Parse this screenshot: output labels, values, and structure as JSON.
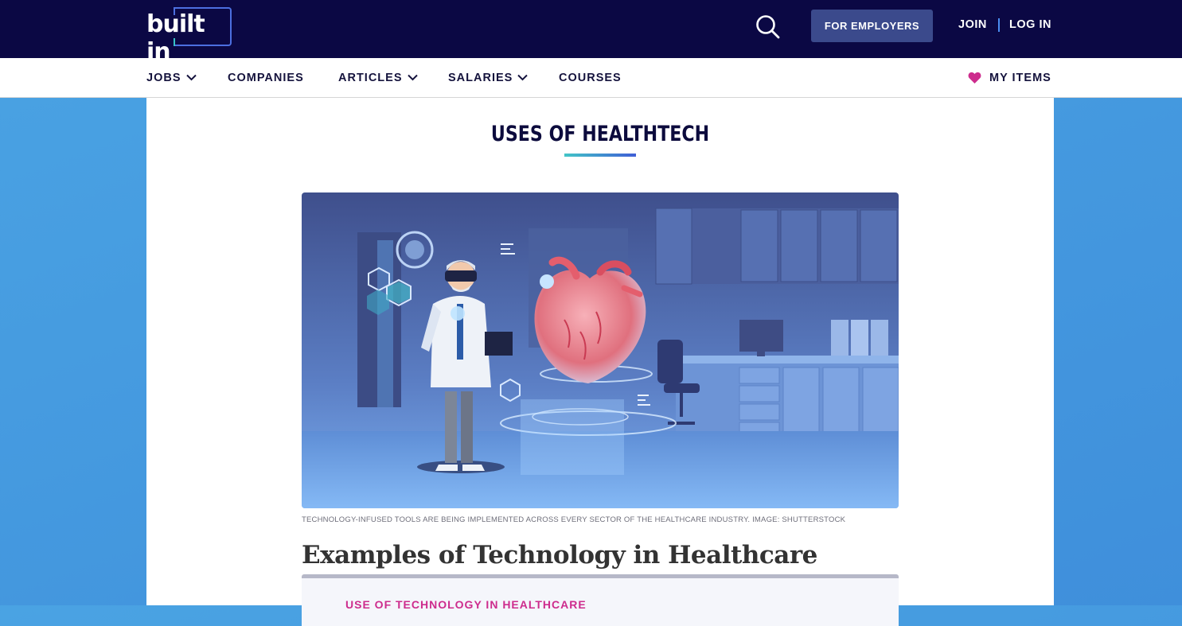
{
  "header": {
    "logo_text": "built in",
    "for_employers": "FOR EMPLOYERS",
    "join": "JOIN",
    "login": "LOG IN"
  },
  "nav": {
    "items": [
      {
        "label": "JOBS",
        "dropdown": true
      },
      {
        "label": "COMPANIES",
        "dropdown": false
      },
      {
        "label": "ARTICLES",
        "dropdown": true
      },
      {
        "label": "SALARIES",
        "dropdown": true
      },
      {
        "label": "COURSES",
        "dropdown": false
      }
    ],
    "my_items": "MY ITEMS"
  },
  "article": {
    "section_title": "USES OF HEALTHTECH",
    "image_caption": "TECHNOLOGY-INFUSED TOOLS ARE BEING IMPLEMENTED ACROSS EVERY SECTOR OF THE HEALTHCARE INDUSTRY. IMAGE: SHUTTERSTOCK",
    "heading": "Examples of Technology in Healthcare",
    "toc_label": "USE OF TECHNOLOGY IN HEALTHCARE"
  },
  "colors": {
    "topbar": "#0b0844",
    "accent_blue": "#3b4a8c",
    "heart_icon": "#cd2c8d",
    "page_background": "#4aa3e3"
  }
}
